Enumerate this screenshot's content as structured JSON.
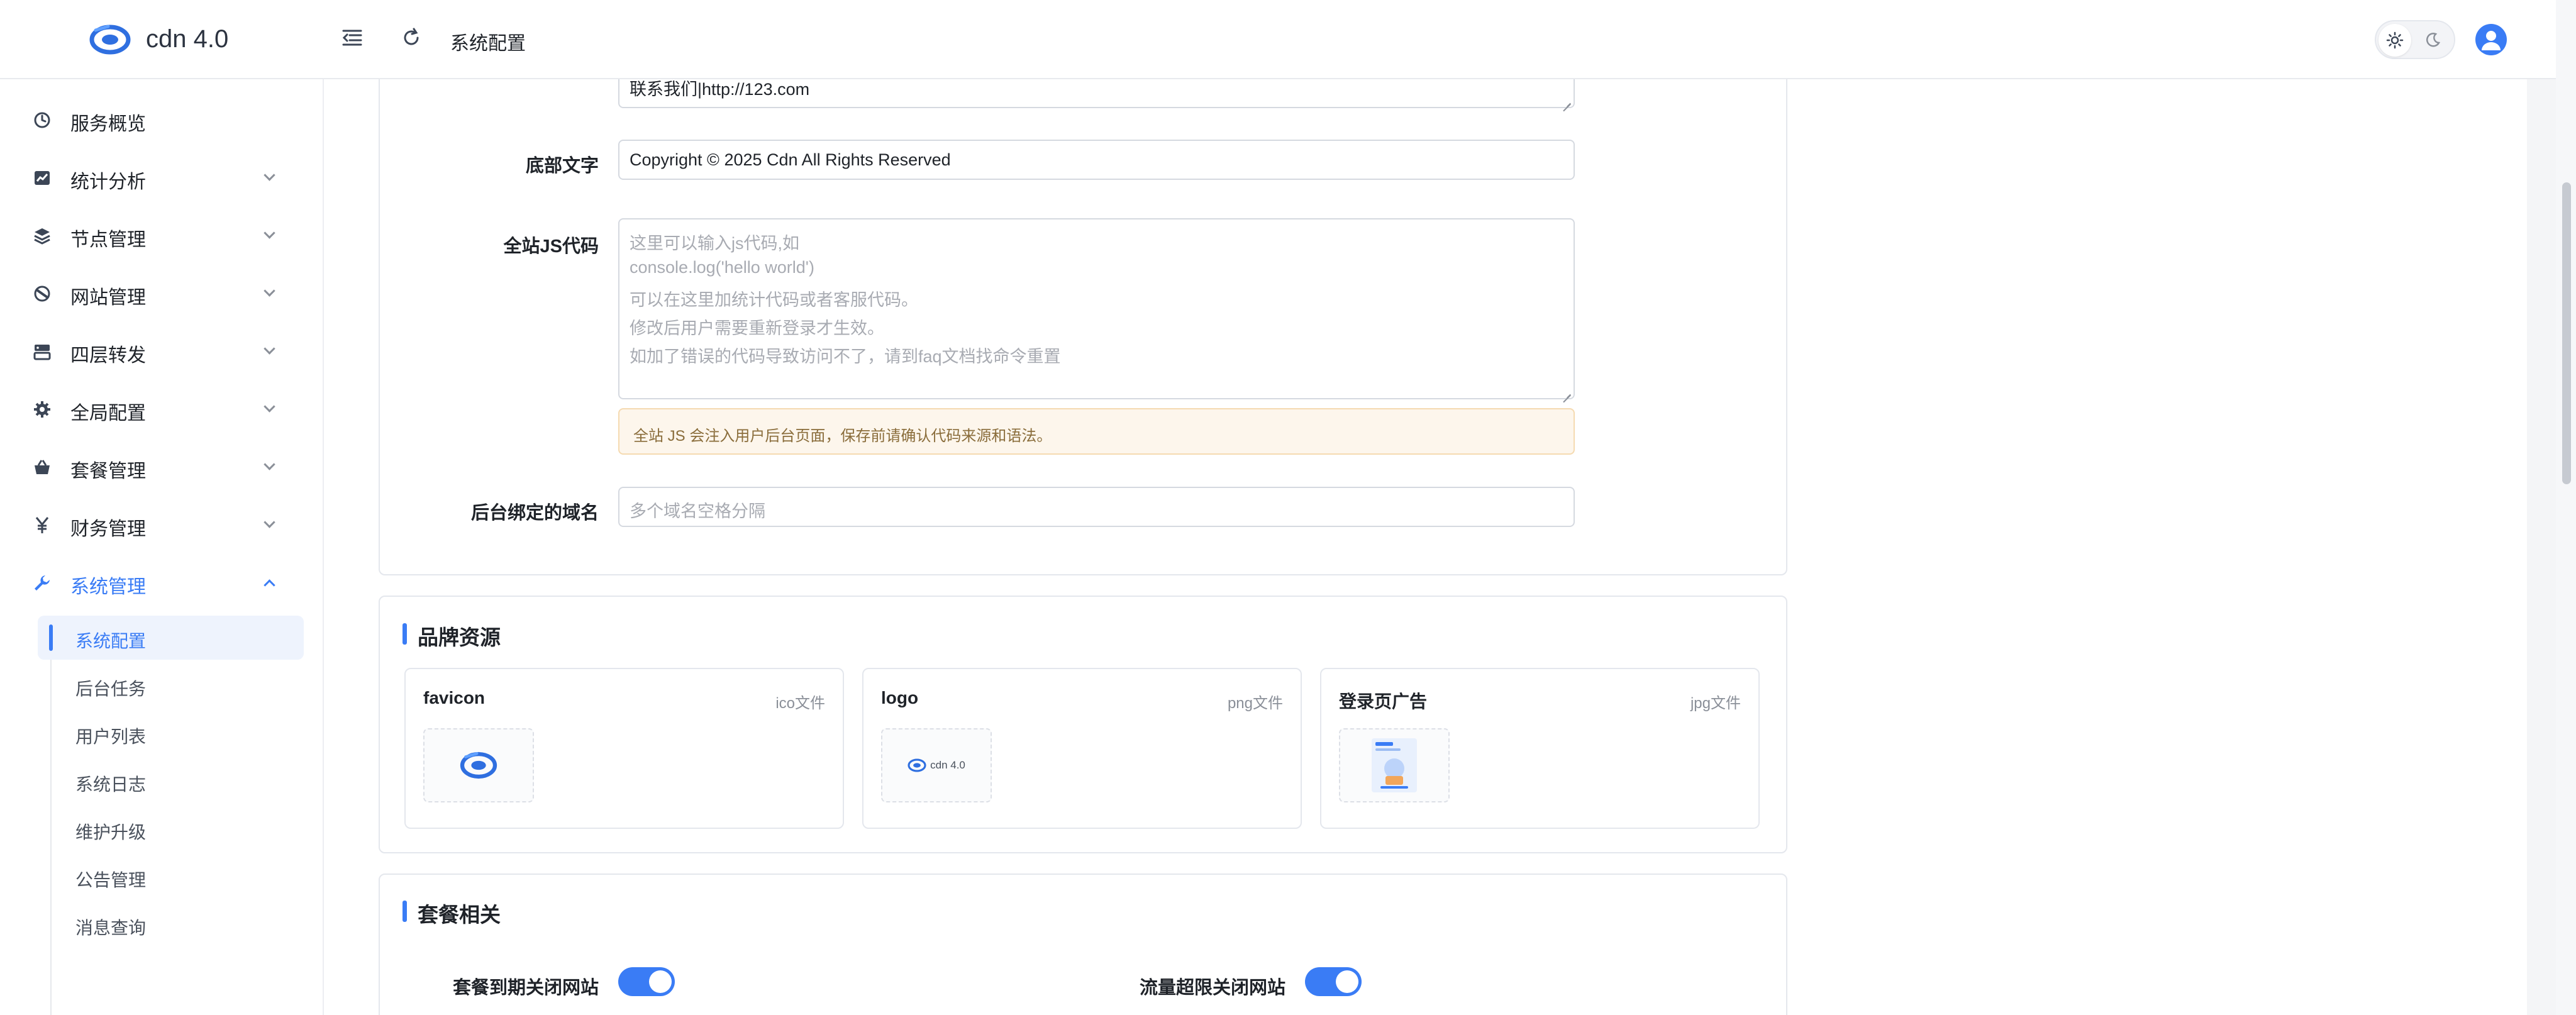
{
  "app": {
    "title": "cdn 4.0"
  },
  "header": {
    "breadcrumb": "系统配置"
  },
  "colors": {
    "accent": "#3a7cf5",
    "notice_bg": "#fdf6ec",
    "notice_text": "#8a6d3b"
  },
  "sidebar": {
    "items": [
      {
        "label": "服务概览",
        "icon": "dashboard-icon",
        "has_children": false
      },
      {
        "label": "统计分析",
        "icon": "chart-icon",
        "has_children": true
      },
      {
        "label": "节点管理",
        "icon": "layers-icon",
        "has_children": true
      },
      {
        "label": "网站管理",
        "icon": "globe-icon",
        "has_children": true
      },
      {
        "label": "四层转发",
        "icon": "server-icon",
        "has_children": true
      },
      {
        "label": "全局配置",
        "icon": "gear-icon",
        "has_children": true
      },
      {
        "label": "套餐管理",
        "icon": "basket-icon",
        "has_children": true
      },
      {
        "label": "财务管理",
        "icon": "yuan-icon",
        "has_children": true
      },
      {
        "label": "系统管理",
        "icon": "wrench-icon",
        "has_children": true,
        "expanded": true
      }
    ],
    "sub_items": [
      {
        "label": "系统配置",
        "active": true
      },
      {
        "label": "后台任务"
      },
      {
        "label": "用户列表"
      },
      {
        "label": "系统日志"
      },
      {
        "label": "维护升级"
      },
      {
        "label": "公告管理"
      },
      {
        "label": "消息查询"
      }
    ]
  },
  "form": {
    "top_textarea": {
      "last_line": "联系我们|http://123.com"
    },
    "footer_text": {
      "label": "底部文字",
      "value": "Copyright © 2025 Cdn All Rights Reserved"
    },
    "site_js": {
      "label": "全站JS代码",
      "placeholder_lines": [
        "这里可以输入js代码,如",
        "console.log('hello world')",
        "可以在这里加统计代码或者客服代码。",
        "修改后用户需要重新登录才生效。",
        "如加了错误的代码导致访问不了，请到faq文档找命令重置"
      ]
    },
    "notice": "全站 JS 会注入用户后台页面，保存前请确认代码来源和语法。",
    "bound_domain": {
      "label": "后台绑定的域名",
      "placeholder": "多个域名空格分隔"
    }
  },
  "brand": {
    "title": "品牌资源",
    "assets": [
      {
        "name": "favicon",
        "type": "ico文件"
      },
      {
        "name": "logo",
        "type": "png文件",
        "thumb_text": "cdn 4.0"
      },
      {
        "name": "登录页广告",
        "type": "jpg文件"
      }
    ]
  },
  "package": {
    "title": "套餐相关",
    "toggles": [
      {
        "label": "套餐到期关闭网站",
        "on": true
      },
      {
        "label": "流量超限关闭网站",
        "on": true
      }
    ]
  }
}
